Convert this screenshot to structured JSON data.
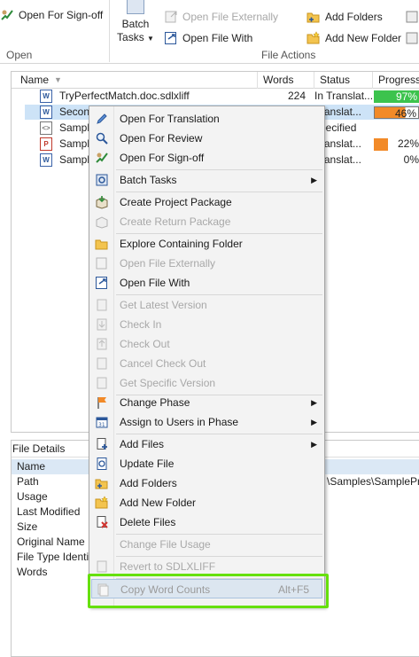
{
  "ribbon": {
    "open_signoff": "Open For Sign-off",
    "batch_tasks_line1": "Batch",
    "batch_tasks_line2": "Tasks",
    "open_externally": "Open File Externally",
    "open_file_with": "Open File With",
    "add_folders": "Add Folders",
    "add_new_folder": "Add New Folder",
    "group_open": "Open",
    "group_file_actions": "File Actions"
  },
  "list": {
    "headers": {
      "name": "Name",
      "words": "Words",
      "status": "Status",
      "progress": "Progress"
    },
    "rows": [
      {
        "name": "TryPerfectMatch.doc.sdlxliff",
        "words": "224",
        "status": "In Translat...",
        "progress": "97%"
      },
      {
        "name": "Second",
        "words": "",
        "status": "Translat...",
        "progress": "46%"
      },
      {
        "name": "Sample",
        "words": "",
        "status": "specified",
        "progress": ""
      },
      {
        "name": "Sample",
        "words": "",
        "status": "Translat...",
        "progress": "22%"
      },
      {
        "name": "Sample",
        "words": "",
        "status": "Translat...",
        "progress": "0%"
      }
    ]
  },
  "details": {
    "title": "File Details",
    "props": [
      {
        "label": "Name",
        "value": ""
      },
      {
        "label": "Path",
        "value": "\\Samples\\SampleProj"
      },
      {
        "label": "Usage",
        "value": ""
      },
      {
        "label": "Last Modified",
        "value": ""
      },
      {
        "label": "Size",
        "value": ""
      },
      {
        "label": "Original Name",
        "value": ""
      },
      {
        "label": "File Type Identif",
        "value": ""
      },
      {
        "label": "Words",
        "value": ""
      }
    ]
  },
  "menu": {
    "open_translation": "Open For Translation",
    "open_review": "Open For Review",
    "open_signoff": "Open For Sign-off",
    "batch_tasks": "Batch Tasks",
    "create_project_package": "Create Project Package",
    "create_return_package": "Create Return Package",
    "explore_folder": "Explore Containing Folder",
    "open_externally": "Open File Externally",
    "open_with": "Open File With",
    "get_latest": "Get Latest Version",
    "check_in": "Check In",
    "check_out": "Check Out",
    "cancel_check_out": "Cancel Check Out",
    "get_specific": "Get Specific Version",
    "change_phase": "Change Phase",
    "assign_users": "Assign to Users in Phase",
    "add_files": "Add Files",
    "update_file": "Update File",
    "add_folders": "Add Folders",
    "add_new_folder": "Add New Folder",
    "delete_files": "Delete Files",
    "change_file_usage": "Change File Usage",
    "revert_sdlxliff": "Revert to SDLXLIFF",
    "copy_word_counts": "Copy Word Counts",
    "copy_word_counts_shortcut": "Alt+F5"
  },
  "colors": {
    "progress_green": "#3cc34d",
    "progress_orange": "#f28a28",
    "highlight_green": "#66e00a",
    "selection_blue": "#cde3f7"
  }
}
